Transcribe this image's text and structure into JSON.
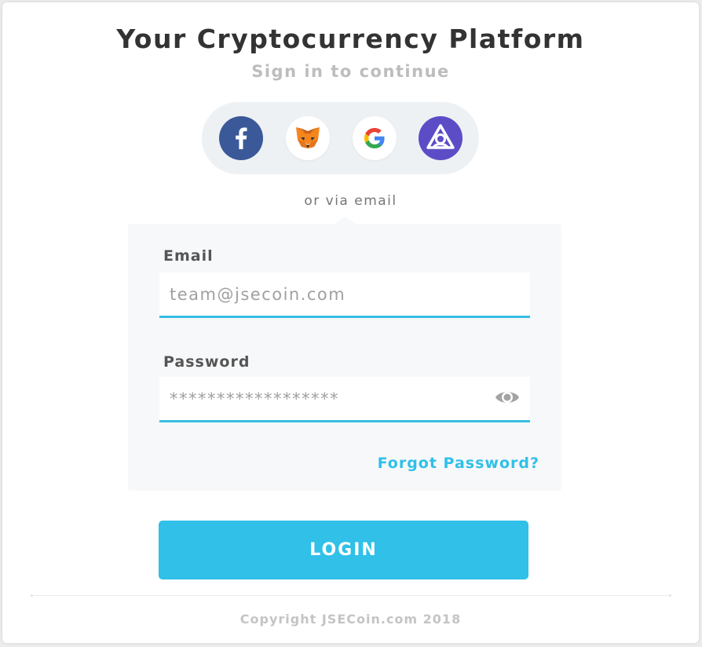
{
  "header": {
    "title": "Your Cryptocurrency Platform",
    "subtitle": "Sign in to continue"
  },
  "social_login": {
    "buttons": [
      {
        "name": "facebook",
        "icon": "facebook-icon",
        "color": "#3b5998"
      },
      {
        "name": "metamask",
        "icon": "metamask-fox-icon",
        "color": "#f6851b"
      },
      {
        "name": "google",
        "icon": "google-g-icon",
        "color": "#4285f4"
      },
      {
        "name": "uport",
        "icon": "uport-icon",
        "color": "#5c4dc6"
      }
    ],
    "divider_text": "or via email"
  },
  "form": {
    "email_label": "Email",
    "email_placeholder": "team@jsecoin.com",
    "password_label": "Password",
    "password_placeholder": "******************",
    "password_toggle_icon": "eye-icon",
    "forgot_password": "Forgot Password?"
  },
  "login_button": "LOGIN",
  "footer": {
    "copyright": "Copyright JSECoin.com 2018"
  },
  "colors": {
    "accent": "#30c0e8",
    "title": "#333333",
    "muted": "#bdbdbd"
  }
}
